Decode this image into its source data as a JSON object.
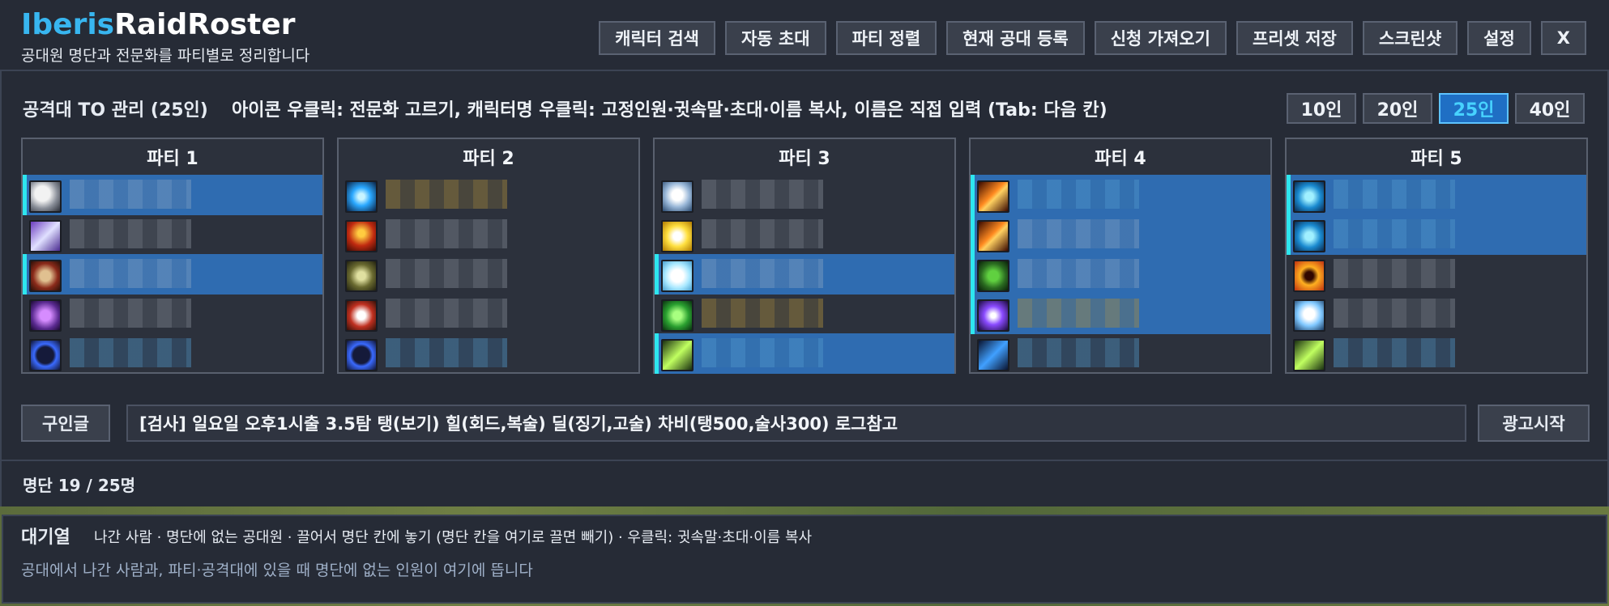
{
  "app": {
    "title_part1": "Iberis",
    "title_part2": "RaidRoster",
    "subtitle": "공대원 명단과 전문화를 파티별로 정리합니다"
  },
  "toolbar": {
    "buttons": [
      "캐릭터 검색",
      "자동 초대",
      "파티 정렬",
      "현재 공대 등록",
      "신청 가져오기",
      "프리셋 저장",
      "스크린샷",
      "설정",
      "X"
    ]
  },
  "raid": {
    "title": "공격대 TO 관리 (25인)",
    "help": "아이콘 우클릭: 전문화 고르기, 캐릭터명 우클릭: 고정인원·귓속말·초대·이름 복사, 이름은 직접 입력 (Tab: 다음 칸)",
    "sizes": [
      "10인",
      "20인",
      "25인",
      "40인"
    ],
    "active_size": "25인"
  },
  "parties": [
    {
      "title": "파티 1",
      "slots": [
        {
          "icon": "shield-warrior-icon",
          "selected": true,
          "name": "",
          "tone": "gray"
        },
        {
          "icon": "paladin-icon",
          "selected": false,
          "name": "",
          "tone": "gray"
        },
        {
          "icon": "warrior-axe-icon",
          "selected": true,
          "name": "",
          "tone": "gray"
        },
        {
          "icon": "hammer-icon",
          "selected": false,
          "name": "",
          "tone": "gray"
        },
        {
          "icon": "shield-icon",
          "selected": false,
          "name": "",
          "tone": "blue"
        }
      ]
    },
    {
      "title": "파티 2",
      "slots": [
        {
          "icon": "frost-orb-icon",
          "selected": false,
          "name": "",
          "tone": "gold"
        },
        {
          "icon": "demon-icon",
          "selected": false,
          "name": "",
          "tone": "gray"
        },
        {
          "icon": "totem-icon",
          "selected": false,
          "name": "",
          "tone": "gray"
        },
        {
          "icon": "fist-icon",
          "selected": false,
          "name": "",
          "tone": "gray"
        },
        {
          "icon": "shield-icon",
          "selected": false,
          "name": "",
          "tone": "blue"
        }
      ]
    },
    {
      "title": "파티 3",
      "slots": [
        {
          "icon": "holy-shield-icon",
          "selected": false,
          "name": "",
          "tone": "gray"
        },
        {
          "icon": "holy-light-icon",
          "selected": false,
          "name": "",
          "tone": "gray"
        },
        {
          "icon": "crystal-icon",
          "selected": true,
          "name": "",
          "tone": "gray"
        },
        {
          "icon": "leaf-icon",
          "selected": false,
          "name": "",
          "tone": "gold"
        },
        {
          "icon": "lightning-claw-icon",
          "selected": true,
          "name": "",
          "tone": "blue"
        }
      ]
    },
    {
      "title": "파티 4",
      "slots": [
        {
          "icon": "fire-icon",
          "selected": true,
          "name": "",
          "tone": "blue"
        },
        {
          "icon": "fire-icon",
          "selected": true,
          "name": "",
          "tone": "gray"
        },
        {
          "icon": "beast-icon",
          "selected": true,
          "name": "",
          "tone": "gray"
        },
        {
          "icon": "shadow-icon",
          "selected": true,
          "name": "",
          "tone": "gold"
        },
        {
          "icon": "lightning-icon",
          "selected": false,
          "name": "",
          "tone": "blue"
        }
      ]
    },
    {
      "title": "파티 5",
      "slots": [
        {
          "icon": "arcane-icon",
          "selected": true,
          "name": "",
          "tone": "blue"
        },
        {
          "icon": "arcane-icon",
          "selected": true,
          "name": "",
          "tone": "blue"
        },
        {
          "icon": "skull-icon",
          "selected": false,
          "name": "",
          "tone": "gray"
        },
        {
          "icon": "ghost-icon",
          "selected": false,
          "name": "",
          "tone": "gray"
        },
        {
          "icon": "lightning-claw-icon",
          "selected": false,
          "name": "",
          "tone": "blue"
        }
      ]
    }
  ],
  "recruit": {
    "label": "구인글",
    "value": "[검사] 일요일 오후1시출 3.5탐 탱(보기) 힐(회드,복술) 딜(징기,고술) 차비(탱500,술사300) 로그참고",
    "ad_button": "광고시작"
  },
  "roster": {
    "count": "명단 19 / 25명"
  },
  "waitlist": {
    "title": "대기열",
    "help": "나간 사람 · 명단에 없는 공대원 · 끌어서 명단 칸에 놓기 (명단 칸을 여기로 끌면 빼기) · 우클릭: 귓속말·초대·이름 복사",
    "empty": "공대에서 나간 사람과, 파티·공격대에 있을 때 명단에 없는 인원이 여기에 뜹니다"
  }
}
